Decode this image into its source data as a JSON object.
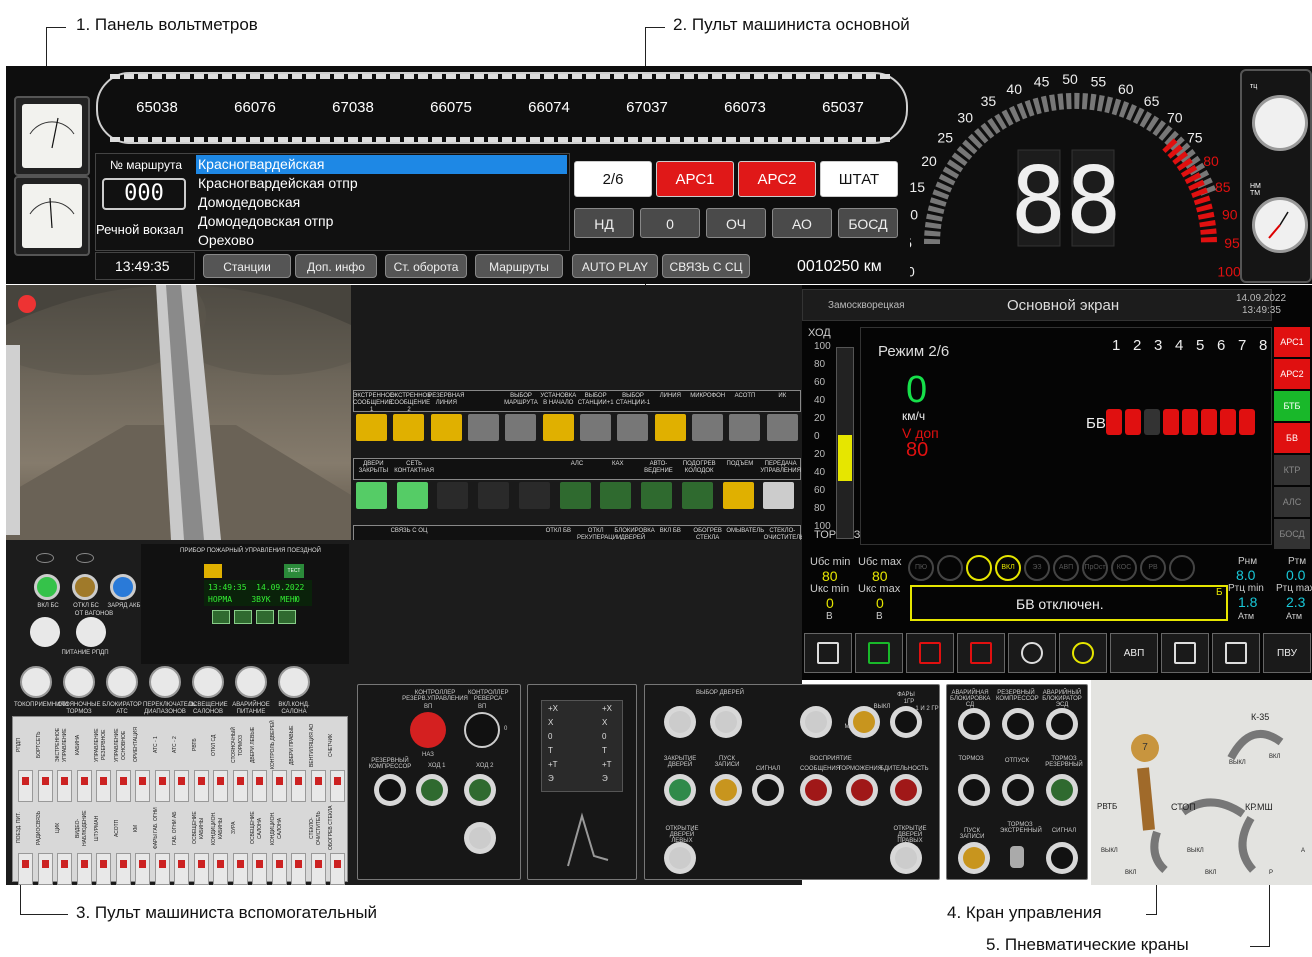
{
  "callouts": {
    "voltmeters": "1. Панель вольтметров",
    "main_console": "2. Пульт машиниста основной",
    "aux_console": "3. Пульт машиниста вспомогательный",
    "control_valve": "4. Кран управления",
    "pneumatic_valves": "5. Пневматические краны"
  },
  "train": {
    "cars": [
      "65038",
      "66076",
      "67038",
      "66075",
      "66074",
      "67037",
      "66073",
      "65037"
    ]
  },
  "route": {
    "label": "№ маршрута",
    "number": "000",
    "depot": "Речной вокзал",
    "time": "13:49:35",
    "stations": [
      "Красногвардейская",
      "Красногвардейская отпр",
      "Домодедовская",
      "Домодедовская отпр",
      "Орехово"
    ]
  },
  "mode_buttons": {
    "row1": [
      "2/6",
      "АРС1",
      "АРС2",
      "ШТАТ"
    ],
    "row2": [
      "НД",
      "0",
      "ОЧ",
      "АО",
      "БОСД"
    ],
    "bottom": [
      "Станции",
      "Доп. инфо",
      "Ст. оборота",
      "Маршруты",
      "AUTO PLAY",
      "СВЯЗЬ С СЦ"
    ],
    "odometer": "0010250 км"
  },
  "speedometer": {
    "ticks": [
      "0",
      "5",
      "10",
      "15",
      "20",
      "25",
      "30",
      "35",
      "40",
      "45",
      "50",
      "55",
      "60",
      "65",
      "70",
      "75",
      "80",
      "85",
      "90",
      "95",
      "100"
    ],
    "value": "88"
  },
  "gauges": {
    "tc": "тц",
    "nm_tm": "НМ ТМ"
  },
  "monitor": {
    "station": "Замоскворецкая",
    "title": "Основной экран",
    "date": "14.09.2022",
    "time": "13:49:35",
    "hod": "ХОД",
    "tormoz": "ТОРМОЗ",
    "scale": [
      "100",
      "80",
      "60",
      "40",
      "20",
      "0",
      "20",
      "40",
      "60",
      "80",
      "100"
    ],
    "mode": "Режим  2/6",
    "speed": "0",
    "speed_unit": "км/ч",
    "vdop_label": "V доп",
    "vdop": "80",
    "cars": [
      "1",
      "2",
      "3",
      "4",
      "5",
      "6",
      "7",
      "8"
    ],
    "bv": "БВ",
    "side_buttons": [
      "АРС1",
      "АРС2",
      "БТБ",
      "БВ",
      "КТР",
      "АЛС",
      "БОСД"
    ],
    "ubc_min_label": "Uбс min",
    "ubc_min": "80",
    "ubc_max_label": "Uбс max",
    "ubc_max": "80",
    "ukc_min_label": "Uкс min",
    "ukc_min": "0",
    "ukc_max_label": "Uкс max",
    "ukc_max": "0",
    "unit_v": "В",
    "message": "БВ отключен.",
    "message_tag": "Б",
    "rnm_label": "Рнм",
    "rnm": "8.0",
    "rtm_label": "Ртм",
    "rtm": "0.0",
    "rtc_min_label": "Ртц min",
    "rtc_min": "1.8",
    "rtc_max_label": "Ртц max",
    "rtc_max": "2.3",
    "unit_atm": "Атм",
    "round_icons": [
      "ПЮ",
      "",
      "",
      "ВКЛ",
      "ЭЗ",
      "АВП",
      "ПрОст",
      "КОС",
      "РВ",
      ""
    ],
    "bottom_icons": [
      "train-icon",
      "doors-icon",
      "heater-icon",
      "lightning-icon",
      "horn-icon",
      "sun-icon",
      "АВП",
      "mail-icon",
      "tools-icon",
      "ПВУ"
    ]
  },
  "main_panel": {
    "row1_labels": [
      "ЭКСТРЕННОЕ СООБЩЕНИЕ 1",
      "ЭКСТРЕННОЕ СООБЩЕНИЕ 2",
      "РЕЗЕРВНАЯ ЛИНИЯ",
      "",
      "ВЫБОР МАРШРУТА",
      "УСТАНОВКА В НАЧАЛО",
      "ВЫБОР СТАНЦИИ+1",
      "ВЫБОР СТАНЦИИ-1",
      "ЛИНИЯ",
      "МИКРОФОН",
      "АСОТП",
      "ИК"
    ],
    "row2_labels": [
      "ДВЕРИ ЗАКРЫТЫ",
      "СЕТЬ КОНТАКТНАЯ",
      "",
      "",
      "",
      "АЛС",
      "КАХ",
      "АВТО-ВЕДЕНИЕ",
      "ПОДОГРЕВ КОЛОДОК",
      "ПОДЪЕМ",
      "ПЕРЕДАЧА УПРАВЛЕНИЯ"
    ],
    "row3_labels": [
      "",
      "СВЯЗЬ С ОЦ",
      "",
      "",
      "",
      "ОТКЛ БВ",
      "ОТКЛ РЕКУПЕРАЦИИ",
      "БЛОКИРОВКА ДВЕРЕЙ",
      "ВКЛ БВ",
      "ОБОГРЕВ СТЕКЛА",
      "ОМЫВАТЕЛЬ",
      "СТЕКЛО-ОЧИСТИТЕЛЬ"
    ]
  },
  "fire": {
    "title": "ПРИБОР ПОЖАРНЫЙ УПРАВЛЕНИЯ ПОЕЗДНОЙ",
    "line1": "13:49:35  14.09.2022",
    "line2": "НОРМА    ЗВУК  МЕНЮ",
    "green_btn": "ТЕСТ"
  },
  "aux": {
    "lamp_labels": [
      "ВКЛ БС",
      "ОТКЛ БС",
      "ЗАРЯД АКБ"
    ],
    "switch_top": [
      "",
      "ОТ ВАГОНОВ"
    ],
    "power": "ПИТАНИЕ РПДП",
    "switch_labels": [
      "ТОКОПРИЕМНИКИ",
      "СТОЯНОЧНЫЕ ТОРМОЗ",
      "БЛОКИРАТОР АТС",
      "ПЕРЕКЛЮЧАТЕЛЬ ДИАПАЗОНОВ",
      "ОСВЕЩЕНИЕ САЛОНОВ",
      "АВАРИЙНОЕ ПИТАНИЕ",
      "ВКЛ.КОНД. САЛОНА"
    ],
    "fuse_row1": [
      "РПДП",
      "БОРТСЕТЬ",
      "ЭКСТРЕННОЕ УПРАВЛЕНИЕ",
      "КАБИНА",
      "УПРАВЛЕНИЕ РЕЗЕРВНОЕ",
      "УПРАВЛЕНИЕ ОСНОВНОЕ",
      "ОРИЕНТАЦИЯ",
      "АТС - 1",
      "АТС - 2",
      "РВТБ",
      "ОТКЛ СД",
      "СТОЯНОЧНЫЙ ТОРМОЗ",
      "ДВЕРИ ЛЕВЫЕ",
      "КОНТРОЛЬ ДВЕРЕЙ",
      "ДВЕРИ ПРАВЫЕ",
      "ВЕНТИЛЯЦИЯ АО",
      "СЧЕТЧИК"
    ],
    "fuse_row2": [
      "ПОЕЗД. ПИТ.",
      "РАДИОСВЯЗЬ",
      "ЦИК",
      "ВИДЕО-НАБЛЮДЕНИЕ",
      "ШТУРМАН",
      "АСОТП",
      "КМ",
      "ФАРЫ ГАБ. ОГНИ",
      "ГАБ. ОГНИ АБ",
      "ОСВЕЩЕНИЕ КАБИНЫ",
      "КОНДИЦИОН. КАБИНЫ",
      "ЗУРА",
      "ОСВЕЩЕНИЕ САЛОНА",
      "КОНДИЦИОН. САЛОНА",
      "",
      "СТЕКЛО-ОЧИСТИТЕЛЬ",
      "ОБОГРЕВ СТЕКЛА"
    ]
  },
  "controller": {
    "title_reserve": "КОНТРОЛЛЕР РЕЗЕРВ.УПРАВЛЕНИЯ",
    "title_reverse": "КОНТРОЛЛЕР РЕВЕРСА",
    "vp": "ВП",
    "naz": "НАЗ",
    "zero": "0",
    "compressor": "РЕЗЕРВНЫЙ КОМПРЕССОР",
    "hod1": "ХОД 1",
    "hod2": "ХОД 2",
    "km_marks": [
      "+X",
      "X",
      "0",
      "T",
      "+T",
      "Э"
    ]
  },
  "doors": {
    "title": "ВЫБОР ДВЕРЕЙ",
    "left": "ЛЕВЫХ",
    "right": "ПРАВЫХ",
    "mic": "МИКРОФОН",
    "headlights": "ФАРЫ",
    "off": "ВЫКЛ",
    "gr1": "1ГР",
    "gr12": "1 И 2 ГР",
    "close": "ЗАКРЫТИЕ ДВЕРЕЙ",
    "rec": "ПУСК ЗАПИСИ",
    "signal": "СИГНАЛ",
    "playback": "ВОСПРИЯТИЕ",
    "msg": "СООБЩЕНИЯ",
    "brake": "ТОРМОЖЕНИЯ",
    "bdit": "БДИТЕЛЬНОСТЬ",
    "open_left": "ОТКРЫТИЕ ДВЕРЕЙ ЛЕВЫХ",
    "open_right": "ОТКРЫТИЕ ДВЕРЕЙ ПРАВЫХ"
  },
  "brakepanel": {
    "a1": "АВАРИЙНАЯ БЛОКИРОВКА СД",
    "a2": "РЕЗЕРВНЫЙ КОМПРЕССОР",
    "a3": "АВАРИЙНЫЙ БЛОКИРАТОР ЭСД",
    "t": "ТОРМОЗ",
    "otp": "ОТПУСК",
    "tres": "ТОРМОЗ РЕЗЕРВНЫЙ",
    "rec": "ПУСК ЗАПИСИ",
    "emerg": "ТОРМОЗ ЭКСТРЕННЫЙ",
    "sig": "СИГНАЛ"
  },
  "pneumatic": {
    "k35": "К-35",
    "vykl": "ВЫКЛ",
    "vkl": "ВКЛ",
    "rvtb": "РВТБ",
    "stop": "СТОП",
    "krmsh": "КР.МШ",
    "a": "А",
    "r": "Р",
    "handle": "7"
  }
}
